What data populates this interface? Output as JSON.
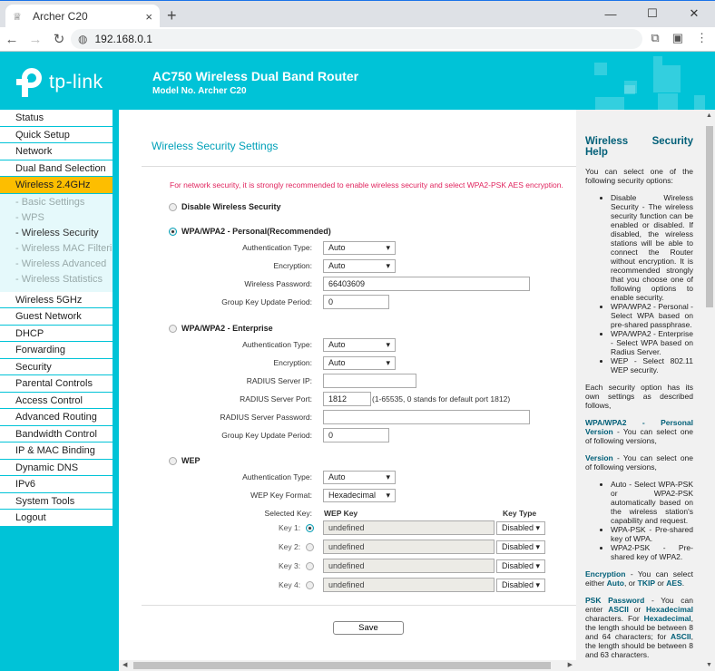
{
  "browser": {
    "tab_title": "Archer C20",
    "tab_icon": "router-favicon",
    "new_tab": "+",
    "close_tab": "×",
    "url": "192.168.0.1",
    "window": {
      "minimize": "—",
      "maximize": "☐",
      "close": "✕"
    }
  },
  "header": {
    "logo_text": "tp-link",
    "title": "AC750 Wireless Dual Band Router",
    "model": "Model No. Archer C20",
    "brand_color": "#00c3d7"
  },
  "sidebar": {
    "items_top": [
      "Status",
      "Quick Setup",
      "Network",
      "Dual Band Selection"
    ],
    "active": "Wireless 2.4GHz",
    "sub_items": [
      {
        "label": "- Basic Settings",
        "selected": false
      },
      {
        "label": "- WPS",
        "selected": false
      },
      {
        "label": "- Wireless Security",
        "selected": true
      },
      {
        "label": "- Wireless MAC Filtering",
        "selected": false
      },
      {
        "label": "- Wireless Advanced",
        "selected": false
      },
      {
        "label": "- Wireless Statistics",
        "selected": false
      }
    ],
    "items_bottom": [
      "Wireless 5GHz",
      "Guest Network",
      "DHCP",
      "Forwarding",
      "Security",
      "Parental Controls",
      "Access Control",
      "Advanced Routing",
      "Bandwidth Control",
      "IP & MAC Binding",
      "Dynamic DNS",
      "IPv6",
      "System Tools",
      "Logout"
    ]
  },
  "main": {
    "title": "Wireless Security Settings",
    "warning": "For network security, it is strongly recommended to enable wireless security and select WPA2-PSK AES encryption.",
    "disable": {
      "label": "Disable Wireless Security",
      "selected": false
    },
    "personal": {
      "label": "WPA/WPA2 - Personal(Recommended)",
      "selected": true,
      "auth_label": "Authentication Type:",
      "auth_value": "Auto",
      "enc_label": "Encryption:",
      "enc_value": "Auto",
      "pwd_label": "Wireless Password:",
      "pwd_value": "66403609",
      "gk_label": "Group Key Update Period:",
      "gk_value": "0"
    },
    "enterprise": {
      "label": "WPA/WPA2 - Enterprise",
      "selected": false,
      "auth_label": "Authentication Type:",
      "auth_value": "Auto",
      "enc_label": "Encryption:",
      "enc_value": "Auto",
      "ip_label": "RADIUS Server IP:",
      "ip_value": "",
      "port_label": "RADIUS Server Port:",
      "port_value": "1812",
      "port_note": "(1-65535, 0 stands for default port 1812)",
      "rpwd_label": "RADIUS Server Password:",
      "rpwd_value": "",
      "gk_label": "Group Key Update Period:",
      "gk_value": "0"
    },
    "wep": {
      "label": "WEP",
      "selected": false,
      "auth_label": "Authentication Type:",
      "auth_value": "Auto",
      "format_label": "WEP Key Format:",
      "format_value": "Hexadecimal",
      "selected_key_label": "Selected Key:",
      "wep_key_header": "WEP Key",
      "key_type_header": "Key Type",
      "keys": [
        {
          "label": "Key 1:",
          "value": "undefined",
          "type": "Disabled",
          "selected": true
        },
        {
          "label": "Key 2:",
          "value": "undefined",
          "type": "Disabled",
          "selected": false
        },
        {
          "label": "Key 3:",
          "value": "undefined",
          "type": "Disabled",
          "selected": false
        },
        {
          "label": "Key 4:",
          "value": "undefined",
          "type": "Disabled",
          "selected": false
        }
      ]
    },
    "save_label": "Save"
  },
  "help": {
    "title": "Wireless Security Help",
    "intro": "You can select one of the following security options:",
    "options": [
      "Disable Wireless Security - The wireless security function can be enabled or disabled. If disabled, the wireless stations will be able to connect the Router without encryption. It is recommended strongly that you choose one of following options to enable security.",
      "WPA/WPA2 - Personal - Select WPA based on pre-shared passphrase.",
      "WPA/WPA2 - Enterprise - Select WPA based on Radius Server.",
      "WEP - Select 802.11 WEP security."
    ],
    "each": "Each security option has its own settings as described follows,",
    "personal_head": "WPA/WPA2 - Personal Version",
    "personal_text": " - You can select one of following versions,",
    "version_head": "Version",
    "version_text": " - You can select one of following versions,",
    "versions": [
      "Auto - Select WPA-PSK or WPA2-PSK automatically based on the wireless station's capability and request.",
      "WPA-PSK - Pre-shared key of WPA.",
      "WPA2-PSK - Pre-shared key of WPA2."
    ],
    "enc_head": "Encryption",
    "enc_text1": " - You can select either ",
    "enc_auto": "Auto",
    "enc_text2": ", or ",
    "enc_tkip": "TKIP",
    "enc_text3": " or ",
    "enc_aes": "AES",
    "enc_text4": ".",
    "psk_head": "PSK Password",
    "psk_text1": " - You can enter ",
    "psk_ascii": "ASCII",
    "psk_text2": " or ",
    "psk_hex": "Hexadecimal",
    "psk_text3": " characters. For ",
    "psk_hex2": "Hexadecimal",
    "psk_text4": ", the length should be between 8 and 64 characters; for ",
    "psk_ascii2": "ASCII",
    "psk_text5": ", the length should be between 8 and 63 characters."
  }
}
